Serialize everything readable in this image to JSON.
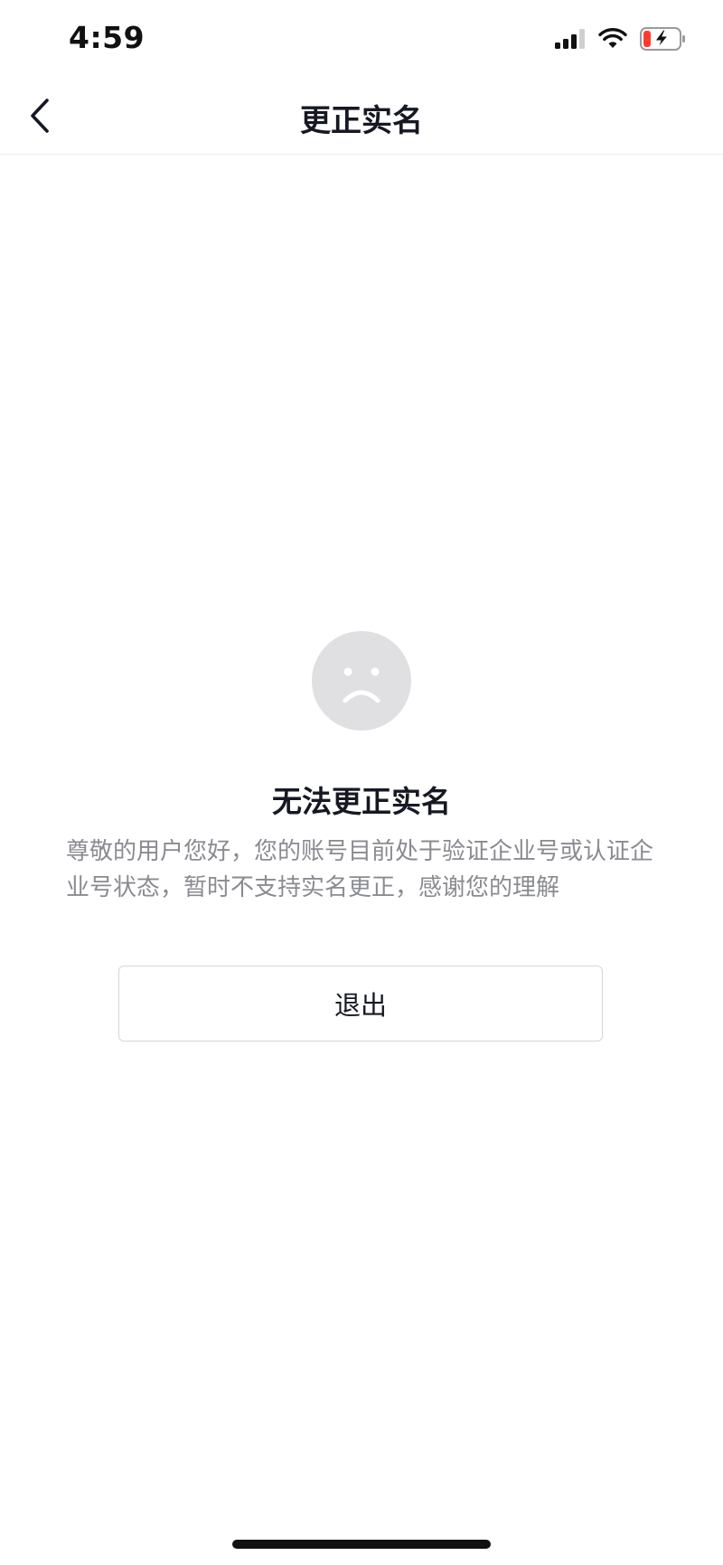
{
  "status_bar": {
    "time": "4:59",
    "icons": [
      "signal-icon",
      "wifi-icon",
      "battery-charging-icon"
    ],
    "battery_level": 0.15,
    "battery_low_color": "#ff3b30"
  },
  "nav": {
    "title": "更正实名",
    "back_icon": "chevron-left-icon"
  },
  "result": {
    "icon": "sad-face-icon",
    "title": "无法更正实名",
    "description": "尊敬的用户您好，您的账号目前处于验证企业号或认证企业号状态，暂时不支持实名更正，感谢您的理解",
    "exit_label": "退出"
  },
  "colors": {
    "text_primary": "#161823",
    "text_secondary": "#8a8b91",
    "icon_bg": "#e0e0e2",
    "divider": "#ececec"
  }
}
